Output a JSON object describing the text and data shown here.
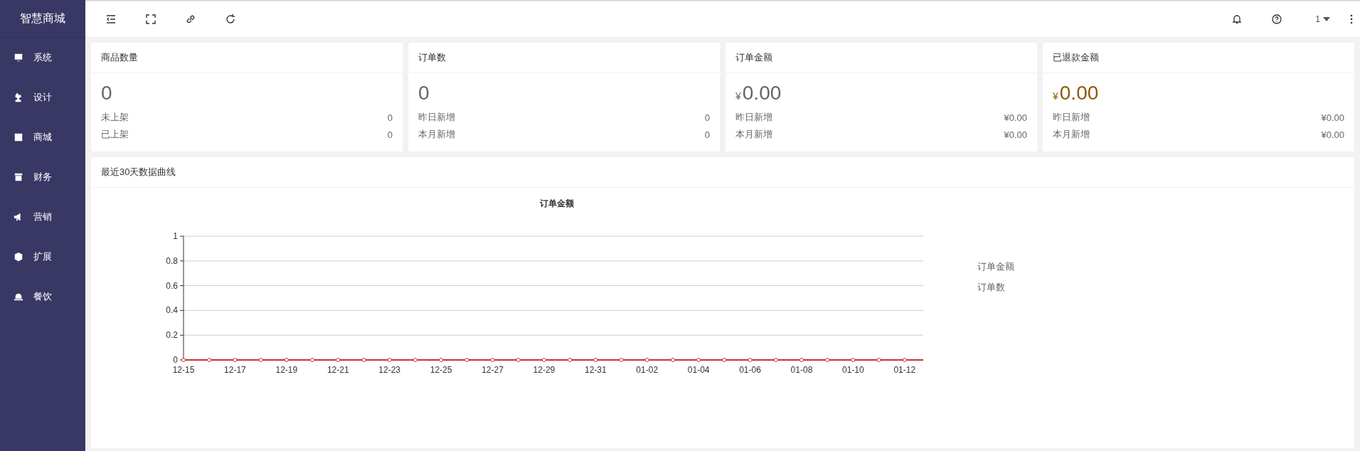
{
  "brand": "智慧商城",
  "sidebar": {
    "items": [
      {
        "label": "系统"
      },
      {
        "label": "设计"
      },
      {
        "label": "商城"
      },
      {
        "label": "财务"
      },
      {
        "label": "营销"
      },
      {
        "label": "扩展"
      },
      {
        "label": "餐饮"
      }
    ]
  },
  "header": {
    "user": "1"
  },
  "stat_cards": [
    {
      "title": "商品数量",
      "value": "0",
      "color": "#666666",
      "rows": [
        {
          "label": "未上架",
          "value": "0"
        },
        {
          "label": "已上架",
          "value": "0"
        }
      ]
    },
    {
      "title": "订单数",
      "value": "0",
      "color": "#666666",
      "rows": [
        {
          "label": "昨日新增",
          "value": "0"
        },
        {
          "label": "本月新增",
          "value": "0"
        }
      ]
    },
    {
      "title": "订单金额",
      "currency": "¥",
      "value": "0.00",
      "color": "#666666",
      "rows": [
        {
          "label": "昨日新增",
          "value": "¥0.00"
        },
        {
          "label": "本月新增",
          "value": "¥0.00"
        }
      ]
    },
    {
      "title": "已退款金额",
      "currency": "¥",
      "value": "0.00",
      "color": "#8c5a06",
      "rows": [
        {
          "label": "昨日新增",
          "value": "¥0.00"
        },
        {
          "label": "本月新增",
          "value": "¥0.00"
        }
      ]
    }
  ],
  "chart_panel": {
    "title": "最近30天数据曲线",
    "legend_items": [
      "订单数"
    ],
    "chart_data": {
      "type": "line",
      "title": "订单金额",
      "categories": [
        "12-15",
        null,
        "12-17",
        null,
        "12-19",
        null,
        "12-21",
        null,
        "12-23",
        null,
        "12-25",
        null,
        "12-27",
        null,
        "12-29",
        null,
        "12-31",
        null,
        "01-02",
        null,
        "01-04",
        null,
        "01-06",
        null,
        "01-08",
        null,
        "01-10",
        null,
        "01-12",
        null
      ],
      "series": [
        {
          "name": "订单金额",
          "color": "#c23531",
          "marker": "circle",
          "values": [
            0,
            0,
            0,
            0,
            0,
            0,
            0,
            0,
            0,
            0,
            0,
            0,
            0,
            0,
            0,
            0,
            0,
            0,
            0,
            0,
            0,
            0,
            0,
            0,
            0,
            0,
            0,
            0,
            0,
            0
          ]
        }
      ],
      "grid": true,
      "ylim": [
        0,
        1
      ],
      "yticks": [
        0,
        0.2,
        0.4,
        0.6,
        0.8,
        1
      ]
    }
  }
}
